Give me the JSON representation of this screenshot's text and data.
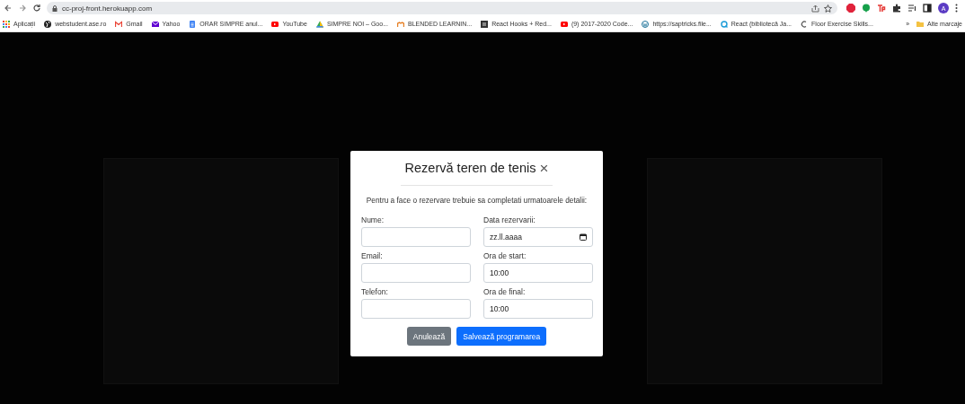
{
  "browser": {
    "url": "cc-proj-front.herokuapp.com",
    "bookmarks": [
      {
        "label": "Aplicații",
        "kind": "grid"
      },
      {
        "label": "webstudent.ase.ro",
        "kind": "globe"
      },
      {
        "label": "Gmail",
        "kind": "mail"
      },
      {
        "label": "Yahoo",
        "kind": "envelope"
      },
      {
        "label": "ORAR SIMPRE anul...",
        "kind": "doc"
      },
      {
        "label": "YouTube",
        "kind": "play"
      },
      {
        "label": "SIMPRE NOI – Goo...",
        "kind": "triangle"
      },
      {
        "label": "BLENDED LEARNIN...",
        "kind": "m"
      },
      {
        "label": "React Hooks + Red...",
        "kind": "square"
      },
      {
        "label": "(9) 2017-2020 Code...",
        "kind": "play"
      },
      {
        "label": "https://saptricks.file...",
        "kind": "wp"
      },
      {
        "label": "React (bibliotecă Ja...",
        "kind": "q"
      },
      {
        "label": "Floor Exercise Skills...",
        "kind": "c"
      }
    ],
    "overflow": "»",
    "other_bookmarks": "Alte marcaje",
    "profile_initial": "A"
  },
  "modal": {
    "title": "Rezervă teren de tenis",
    "close": "×",
    "intro": "Pentru a face o rezervare trebuie sa completati urmatoarele detalii:",
    "fields": [
      {
        "label": "Nume:",
        "kind": "text"
      },
      {
        "label": "Data rezervarii:",
        "kind": "date",
        "value": "zz.ll.aaaa"
      },
      {
        "label": "Email:",
        "kind": "text"
      },
      {
        "label": "Ora de start:",
        "kind": "text",
        "value": "10:00"
      },
      {
        "label": "Telefon:",
        "kind": "text"
      },
      {
        "label": "Ora de final:",
        "kind": "text",
        "value": "10:00"
      }
    ],
    "buttons": [
      {
        "label": "Anulează",
        "kind": "secondary"
      },
      {
        "label": "Salvează programarea",
        "kind": "primary"
      }
    ]
  }
}
